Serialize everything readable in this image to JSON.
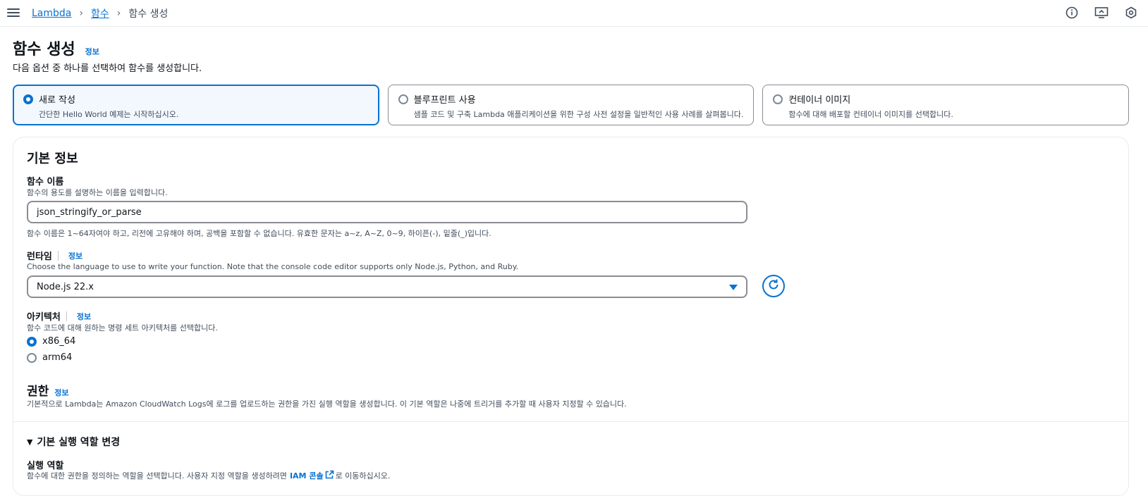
{
  "breadcrumb": {
    "root": "Lambda",
    "parent": "함수",
    "current": "함수 생성"
  },
  "header": {
    "title": "함수 생성",
    "info": "정보",
    "description": "다음 옵션 중 하나를 선택하여 함수를 생성합니다."
  },
  "options": [
    {
      "title": "새로 작성",
      "subtitle": "간단한 Hello World 예제는 시작하십시오.",
      "selected": true
    },
    {
      "title": "블루프린트 사용",
      "subtitle": "샘플 코드 및 구축 Lambda 애플리케이션을 위한 구성 사전 설정을 일반적인 사용 사례를 살펴봅니다.",
      "selected": false
    },
    {
      "title": "컨테이너 이미지",
      "subtitle": "함수에 대해 배포할 컨테이너 이미지를 선택합니다.",
      "selected": false
    }
  ],
  "basic": {
    "title": "기본 정보",
    "function_name": {
      "label": "함수 이름",
      "description": "함수의 용도를 설명하는 이름을 입력합니다.",
      "value": "json_stringify_or_parse",
      "constraint": "함수 이름은 1~64자여야 하고, 리전에 고유해야 하며, 공백을 포함할 수 없습니다. 유효한 문자는 a~z, A~Z, 0~9, 하이픈(-), 밑줄(_)입니다."
    },
    "runtime": {
      "label": "런타임",
      "info": "정보",
      "description": "Choose the language to use to write your function. Note that the console code editor supports only Node.js, Python, and Ruby.",
      "value": "Node.js 22.x"
    },
    "architecture": {
      "label": "아키텍처",
      "info": "정보",
      "description": "함수 코드에 대해 원하는 명령 세트 아키텍처를 선택합니다.",
      "options": [
        "x86_64",
        "arm64"
      ],
      "selected": "x86_64"
    },
    "permissions": {
      "title": "권한",
      "info": "정보",
      "description": "기본적으로 Lambda는 Amazon CloudWatch Logs에 로그를 업로드하는 권한을 가진 실행 역할을 생성합니다. 이 기본 역할은 나중에 트리거를 추가할 때 사용자 지정할 수 있습니다."
    },
    "execution_role": {
      "expand_label": "기본 실행 역할 변경",
      "label": "실행 역할",
      "description_prefix": "함수에 대한 권한을 정의하는 역할을 선택합니다. 사용자 지정 역할을 생성하려면",
      "link": "IAM 콘솔",
      "description_suffix": "로 이동하십시오."
    }
  },
  "colors": {
    "accent": "#0972d3",
    "text": "#0f141a",
    "muted": "#414d5c"
  }
}
